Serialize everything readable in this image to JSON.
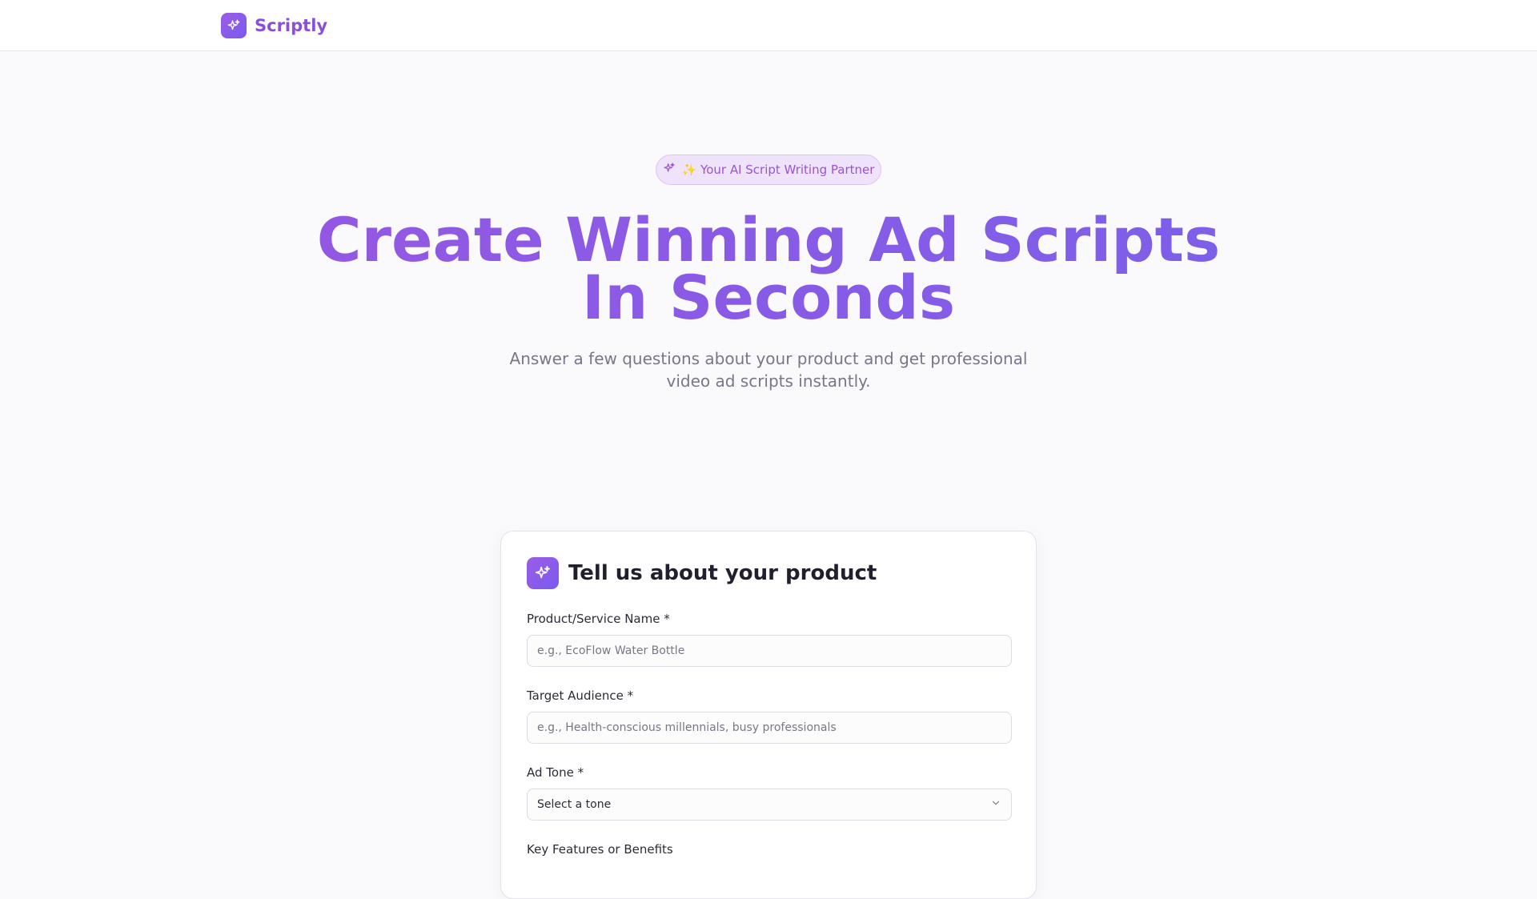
{
  "header": {
    "brand_name": "Scriptly",
    "brand_icon": "sparkles-icon"
  },
  "hero": {
    "badge_text": "✨ Your AI Script Writing Partner",
    "headline_line1": "Create Winning Ad Scripts",
    "headline_line2": "In Seconds",
    "subheadline": "Answer a few questions about your product and get professional video ad scripts instantly."
  },
  "form": {
    "title": "Tell us about your product",
    "product_name": {
      "label": "Product/Service Name *",
      "placeholder": "e.g., EcoFlow Water Bottle",
      "value": ""
    },
    "target_audience": {
      "label": "Target Audience *",
      "placeholder": "e.g., Health-conscious millennials, busy professionals",
      "value": ""
    },
    "ad_tone": {
      "label": "Ad Tone *",
      "selected": "Select a tone"
    },
    "key_features": {
      "label": "Key Features or Benefits"
    }
  },
  "colors": {
    "brand": "#8a4fd8",
    "accent_gradient_start": "#9b5de5",
    "accent_gradient_end": "#7a5af0",
    "badge_bg": "#efe3fb"
  }
}
